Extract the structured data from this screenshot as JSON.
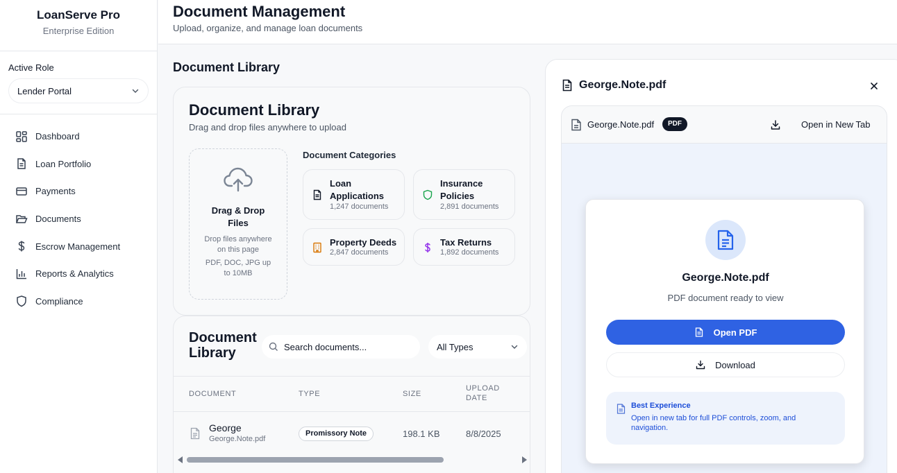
{
  "app": {
    "name": "LoanServe Pro",
    "edition": "Enterprise Edition"
  },
  "role": {
    "label": "Active Role",
    "selected": "Lender Portal"
  },
  "sidebar": {
    "items": [
      {
        "label": "Dashboard",
        "icon": "dashboard-icon"
      },
      {
        "label": "Loan Portfolio",
        "icon": "file-icon"
      },
      {
        "label": "Payments",
        "icon": "credit-card-icon"
      },
      {
        "label": "Documents",
        "icon": "folder-open-icon"
      },
      {
        "label": "Escrow Management",
        "icon": "dollar-icon"
      },
      {
        "label": "Reports & Analytics",
        "icon": "bar-chart-icon"
      },
      {
        "label": "Compliance",
        "icon": "shield-icon"
      }
    ]
  },
  "header": {
    "title": "Document Management",
    "subtitle": "Upload, organize, and manage loan documents"
  },
  "main": {
    "section_title": "Document Library"
  },
  "upload": {
    "title": "Document Library",
    "subtitle": "Drag and drop files anywhere to upload",
    "dropzone": {
      "title": "Drag & Drop Files",
      "desc": "Drop files anywhere on this page",
      "limits": "PDF, DOC, JPG up to 10MB"
    },
    "categories_title": "Document Categories",
    "categories": [
      {
        "name": "Loan Applications",
        "count": "1,247 documents",
        "icon": "document-icon",
        "color": "#111827"
      },
      {
        "name": "Insurance Policies",
        "count": "2,891 documents",
        "icon": "shield-icon",
        "color": "#16a34a"
      },
      {
        "name": "Property Deeds",
        "count": "2,847 documents",
        "icon": "building-icon",
        "color": "#d97706"
      },
      {
        "name": "Tax Returns",
        "count": "1,892 documents",
        "icon": "dollar-icon",
        "color": "#9333ea"
      }
    ]
  },
  "library": {
    "title": "Document Library",
    "search_placeholder": "Search documents...",
    "type_filter": "All Types",
    "columns": [
      "DOCUMENT",
      "TYPE",
      "SIZE",
      "UPLOAD DATE"
    ],
    "rows": [
      {
        "name": "George",
        "file": "George.Note.pdf",
        "type": "Promissory Note",
        "size": "198.1 KB",
        "date": "8/8/2025"
      }
    ]
  },
  "preview": {
    "title": "George.Note.pdf",
    "file": "George.Note.pdf",
    "badge": "PDF",
    "open_new_tab": "Open in New Tab",
    "card_title": "George.Note.pdf",
    "card_sub": "PDF document ready to view",
    "open_button": "Open PDF",
    "download_button": "Download",
    "tip_title": "Best Experience",
    "tip_body": "Open in new tab for full PDF controls, zoom, and navigation."
  },
  "colors": {
    "primary": "#2f62e3",
    "accent_light": "#eef3fc",
    "tip_text": "#1d4ed8"
  }
}
